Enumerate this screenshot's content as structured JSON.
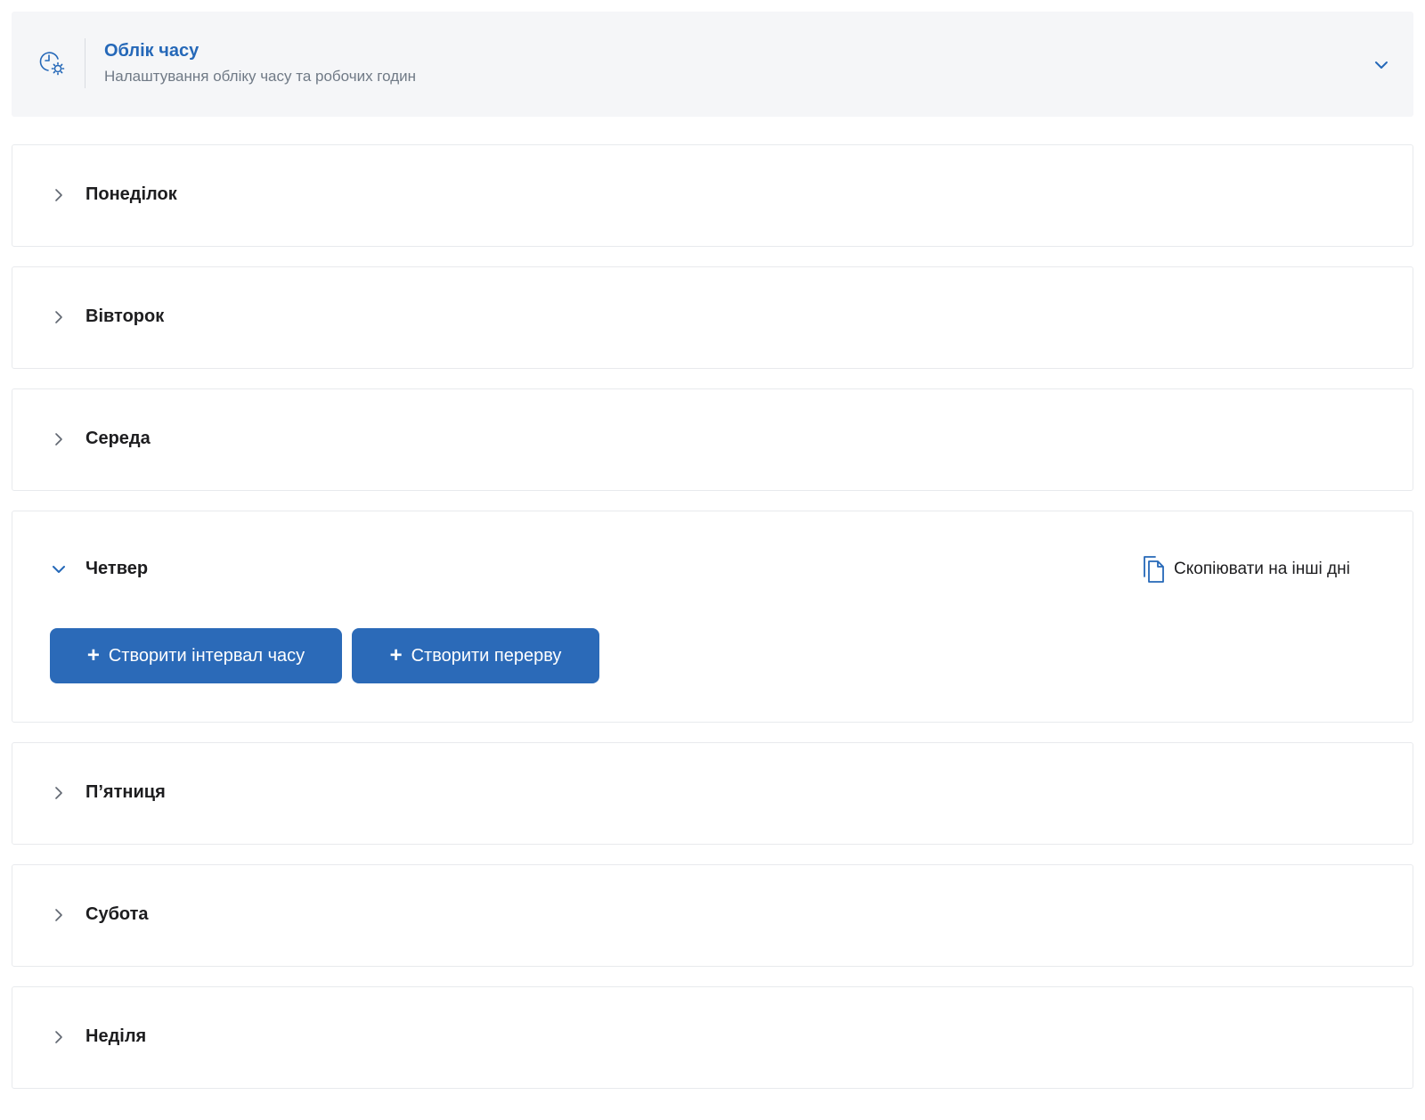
{
  "header": {
    "title": "Облік часу",
    "subtitle": "Налаштування обліку часу та робочих годин",
    "icon": "clock-settings-icon"
  },
  "days": [
    {
      "label": "Понеділок",
      "expanded": false
    },
    {
      "label": "Вівторок",
      "expanded": false
    },
    {
      "label": "Середа",
      "expanded": false
    },
    {
      "label": "Четвер",
      "expanded": true
    },
    {
      "label": "П’ятниця",
      "expanded": false
    },
    {
      "label": "Субота",
      "expanded": false
    },
    {
      "label": "Неділя",
      "expanded": false
    }
  ],
  "thursday": {
    "copy_label": "Скопіювати на інші дні",
    "create_interval_label": "Створити інтервал часу",
    "create_break_label": "Створити перерву"
  },
  "colors": {
    "accent": "#2b6ab8",
    "title": "#2568b8",
    "header_bg": "#f5f6f8"
  }
}
